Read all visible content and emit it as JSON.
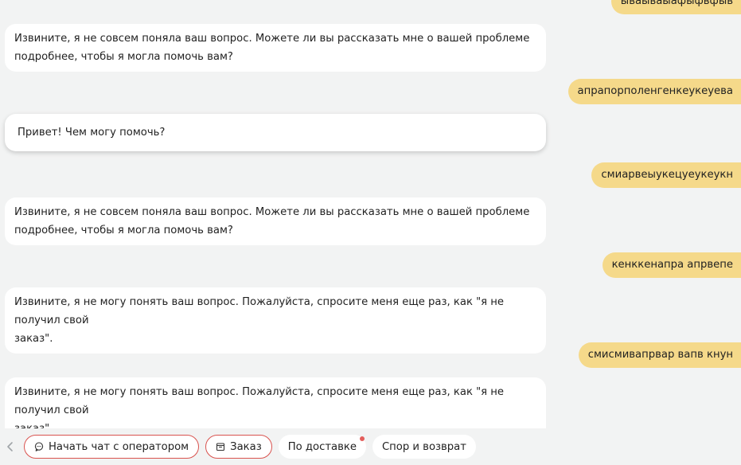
{
  "messages": [
    {
      "role": "user",
      "text": "ываываыафыфвфыв"
    },
    {
      "role": "bot",
      "line1": "Извините, я не совсем поняла ваш вопрос. Можете ли вы рассказать мне о вашей проблеме",
      "line2": "подробнее, чтобы я могла помочь вам?"
    },
    {
      "role": "user",
      "text": "апрапорполенгенкеукеуева"
    },
    {
      "role": "bot",
      "line1": "Привет! Чем могу помочь?"
    },
    {
      "role": "user",
      "text": "смиарвеыукецуеукеукн"
    },
    {
      "role": "bot",
      "line1": "Извините, я не совсем поняла ваш вопрос. Можете ли вы рассказать мне о вашей проблеме",
      "line2": "подробнее, чтобы я могла помочь вам?"
    },
    {
      "role": "user",
      "text": "кенккенапра апрвепе"
    },
    {
      "role": "bot",
      "line1": "Извините, я не могу понять ваш вопрос. Пожалуйста, спросите меня еще раз, как \"я не получил свой",
      "line2": "заказ\"."
    },
    {
      "role": "user",
      "text": "смисмивапрвар вапв кнун"
    },
    {
      "role": "bot",
      "line1": "Извините, я не могу понять ваш вопрос. Пожалуйста, спросите меня еще раз, как \"я не получил свой",
      "line2": "заказ\"."
    }
  ],
  "quick_replies": {
    "back_icon": "chevron-left-icon",
    "operator": {
      "label": "Начать чат с оператором",
      "icon": "chat-bubble-icon"
    },
    "order": {
      "label": "Заказ",
      "icon": "box-icon"
    },
    "delivery": {
      "label": "По доставке"
    },
    "dispute": {
      "label": "Спор и возврат"
    }
  },
  "colors": {
    "background": "#f2f3f3",
    "user_bubble": "#f5d98a",
    "bot_bubble": "#ffffff",
    "accent_border": "#d9534f",
    "badge_dot": "#e35d5b"
  }
}
